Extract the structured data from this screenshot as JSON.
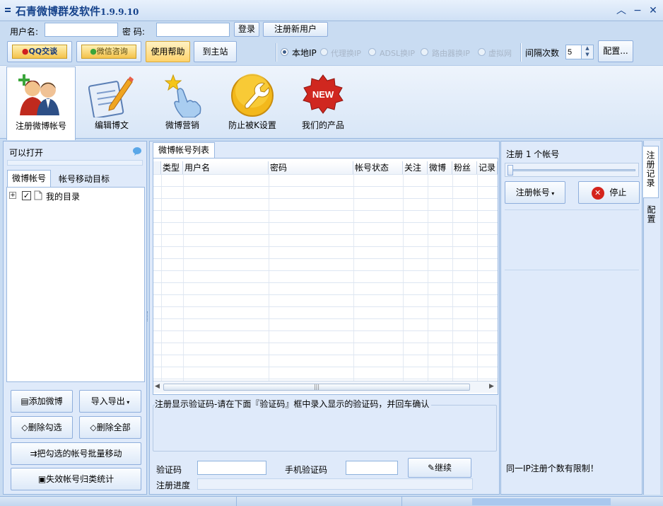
{
  "window": {
    "title": "石青微博群发软件",
    "version": "1.9.9.10",
    "menu_icon": "menu-icon",
    "min_icon": "chevron-up-icon",
    "max_icon": "minus-icon",
    "close_icon": "close-icon"
  },
  "login": {
    "username_label": "用户名:",
    "username_value": "",
    "password_label": "密  码:",
    "password_value": "",
    "login_button": "登录",
    "register_button": "注册新用户"
  },
  "toolbar": {
    "qq_button": "QQ交谈",
    "wechat_button": "微信咨询",
    "help_button": "使用帮助",
    "site_button": "到主站",
    "ip_options": [
      {
        "label": "本地IP",
        "selected": true,
        "enabled": true
      },
      {
        "label": "代理换IP",
        "selected": false,
        "enabled": false
      },
      {
        "label": "ADSL换IP",
        "selected": false,
        "enabled": false
      },
      {
        "label": "路由器换IP",
        "selected": false,
        "enabled": false
      },
      {
        "label": "虚拟网",
        "selected": false,
        "enabled": false
      }
    ],
    "interval_label": "间隔次数",
    "interval_value": "5",
    "config_button": "配置..."
  },
  "tools": [
    {
      "label": "注册微博帐号",
      "icon": "users-icon",
      "active": true
    },
    {
      "label": "编辑博文",
      "icon": "edit-document-icon",
      "active": false
    },
    {
      "label": "微博营销",
      "icon": "hand-star-icon",
      "active": false
    },
    {
      "label": "防止被K设置",
      "icon": "wrench-icon",
      "active": false
    },
    {
      "label": "我们的产品",
      "icon": "new-badge-icon",
      "active": false
    }
  ],
  "left_panel": {
    "title": "可以打开",
    "tabs": [
      "微博帐号",
      "帐号移动目标"
    ],
    "tree": [
      {
        "label": "我的目录",
        "checked": true
      }
    ],
    "buttons": {
      "add": "添加微博",
      "import": "导入导出",
      "del_checked": "删除勾选",
      "del_all": "删除全部",
      "batch_move": "把勾选的帐号批量移动",
      "stats": "失效帐号归类统计"
    }
  },
  "list_panel": {
    "tab": "微博帐号列表",
    "columns": [
      "类型",
      "用户名",
      "密码",
      "帐号状态",
      "关注",
      "微博",
      "粉丝",
      "记录"
    ],
    "rows": [],
    "captcha_hint": "注册显示验证码-请在下面『验证码』框中录入显示的验证码，并回车确认",
    "captcha_label": "验证码",
    "captcha_value": "",
    "phone_label": "手机验证码",
    "phone_value": "",
    "continue_button": "继续",
    "progress_label": "注册进度",
    "progress": 0
  },
  "right_panel": {
    "count_label": "注册 1 个帐号",
    "slider_value": 1,
    "register_button": "注册帐号",
    "stop_button": "停止",
    "note": "同一IP注册个数有限制！",
    "vtabs": [
      "注册记录",
      "配置"
    ]
  }
}
